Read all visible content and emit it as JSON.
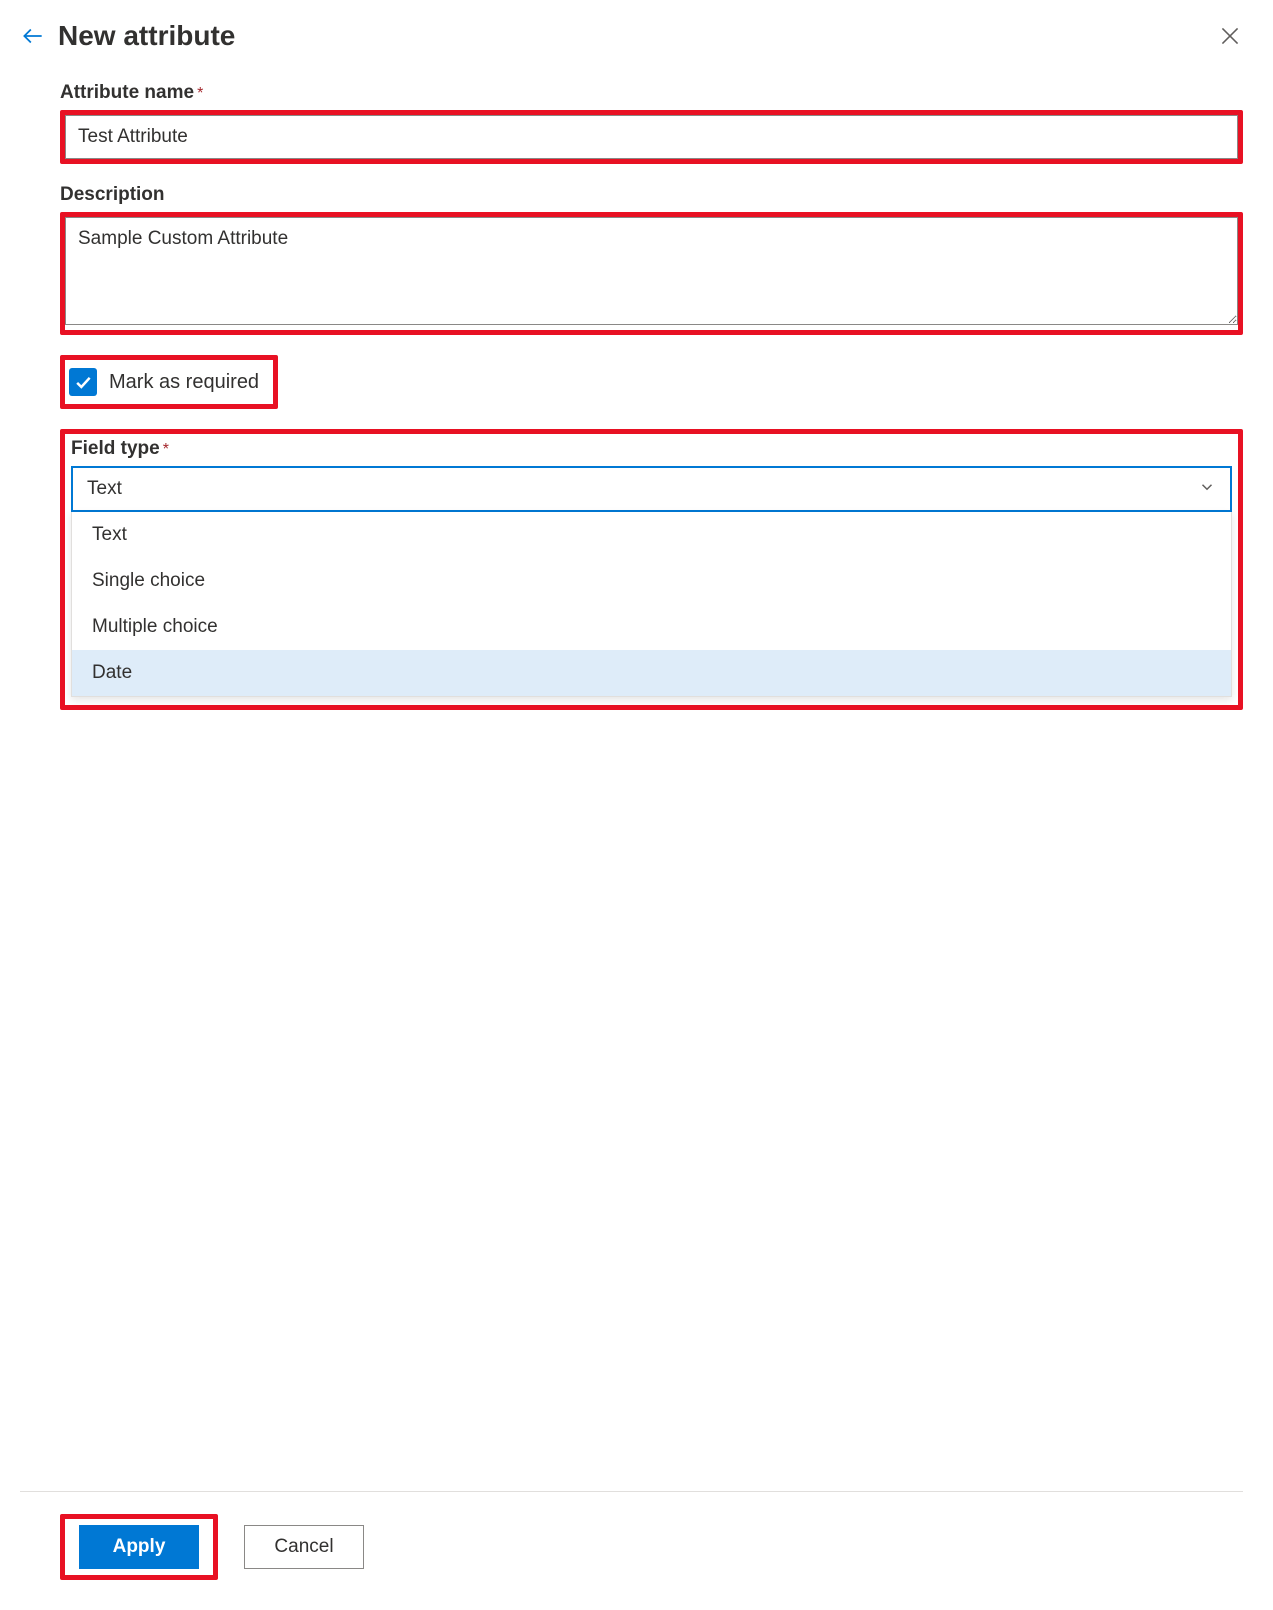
{
  "header": {
    "title": "New attribute"
  },
  "form": {
    "attribute_name_label": "Attribute name",
    "attribute_name_value": "Test Attribute",
    "description_label": "Description",
    "description_value": "Sample Custom Attribute",
    "mark_required_label": "Mark as required",
    "mark_required_checked": true,
    "field_type_label": "Field type",
    "field_type_selected": "Text",
    "field_type_options": [
      "Text",
      "Single choice",
      "Multiple choice",
      "Date"
    ],
    "field_type_highlighted_index": 3
  },
  "footer": {
    "apply_label": "Apply",
    "cancel_label": "Cancel"
  }
}
